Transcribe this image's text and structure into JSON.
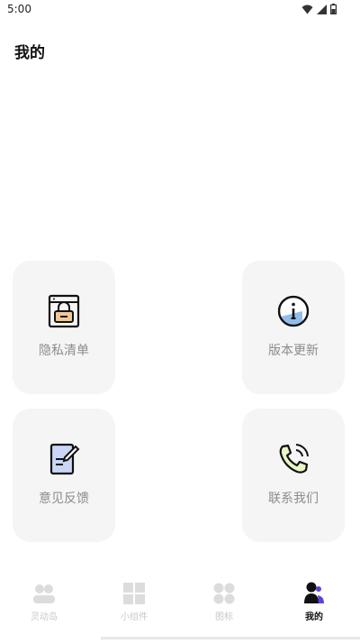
{
  "status_bar": {
    "time": "5:00",
    "icons": [
      "wifi-icon",
      "signal-icon",
      "battery-icon"
    ]
  },
  "header": {
    "title": "我的"
  },
  "menu": {
    "items": [
      {
        "label": "隐私清单",
        "icon": "privacy-list-icon"
      },
      {
        "label": "版本更新",
        "icon": "info-icon"
      },
      {
        "label": "意见反馈",
        "icon": "feedback-icon"
      },
      {
        "label": "联系我们",
        "icon": "phone-icon"
      }
    ]
  },
  "tabbar": {
    "tabs": [
      {
        "label": "灵动岛",
        "icon": "island-icon",
        "active": false
      },
      {
        "label": "小组件",
        "icon": "widgets-icon",
        "active": false
      },
      {
        "label": "图标",
        "icon": "icons-grid-icon",
        "active": false
      },
      {
        "label": "我的",
        "icon": "profile-icon",
        "active": true
      }
    ]
  },
  "colors": {
    "accent_blue": "#7fb2e8",
    "accent_purple": "#5a45d6",
    "card_bg": "#f5f5f5",
    "label_gray": "#8c8c8c"
  }
}
